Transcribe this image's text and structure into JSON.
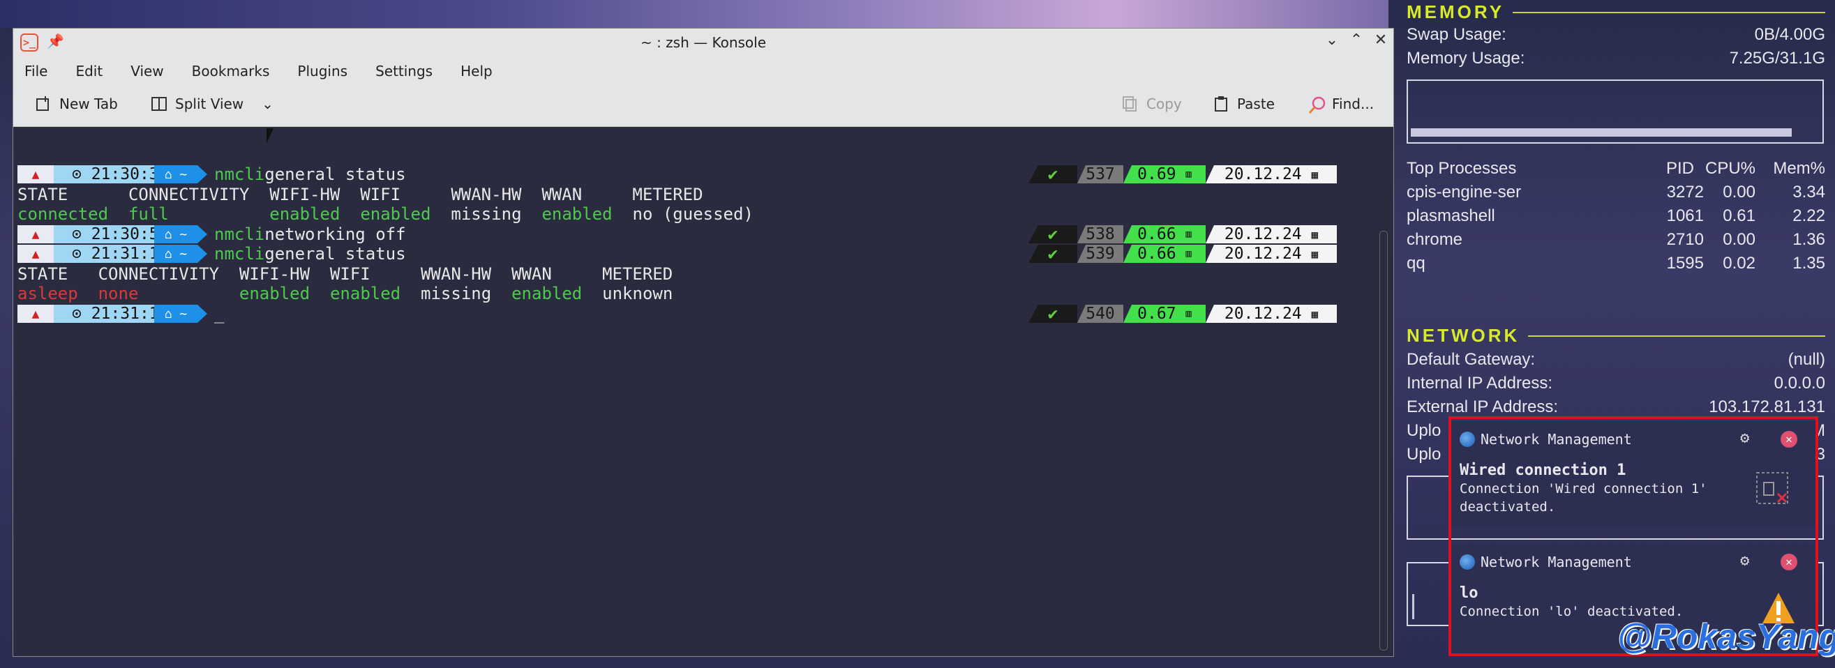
{
  "window": {
    "title": "~ : zsh — Konsole",
    "menu": [
      "File",
      "Edit",
      "View",
      "Bookmarks",
      "Plugins",
      "Settings",
      "Help"
    ],
    "toolbar": {
      "new_tab": "New Tab",
      "split_view": "Split View",
      "copy": "Copy",
      "paste": "Paste",
      "find": "Find..."
    }
  },
  "terminal": {
    "prompts": [
      {
        "time": "21:30:35",
        "home": "~",
        "cmd": "nmcli",
        "args": " general status",
        "status": "✔",
        "num": "537",
        "load": "0.69",
        "date": "20.12.24"
      },
      {
        "time": "21:30:59",
        "home": "~",
        "cmd": "nmcli",
        "args": " networking off",
        "status": "✔",
        "num": "538",
        "load": "0.66",
        "date": "20.12.24"
      },
      {
        "time": "21:31:11",
        "home": "~",
        "cmd": "nmcli",
        "args": " general status",
        "status": "✔",
        "num": "539",
        "load": "0.66",
        "date": "20.12.24"
      },
      {
        "time": "21:31:14",
        "home": "~",
        "cmd": "",
        "args": "_",
        "status": "✔",
        "num": "540",
        "load": "0.67",
        "date": "20.12.24"
      }
    ],
    "out1_header": "STATE      CONNECTIVITY  WIFI-HW  WIFI     WWAN-HW  WWAN     METERED",
    "out1_state": "connected",
    "out1_conn": "full",
    "out1_wifihw": "enabled",
    "out1_wifi": "enabled",
    "out1_wwanhw": "missing",
    "out1_wwan": "enabled",
    "out1_metered": "no (guessed)",
    "out2_header": "STATE   CONNECTIVITY  WIFI-HW  WIFI     WWAN-HW  WWAN     METERED",
    "out2_state": "asleep",
    "out2_conn": "none",
    "out2_wifihw": "enabled",
    "out2_wifi": "enabled",
    "out2_wwanhw": "missing",
    "out2_wwan": "enabled",
    "out2_metered": "unknown"
  },
  "memory": {
    "heading": "MEMORY",
    "swap_label": "Swap Usage:",
    "swap_value": "0B/4.00G",
    "mem_label": "Memory Usage:",
    "mem_value": "7.25G/31.1G"
  },
  "processes": {
    "headers": [
      "Top Processes",
      "PID",
      "CPU%",
      "Mem%"
    ],
    "rows": [
      [
        "cpis-engine-ser",
        "3272",
        "0.00",
        "3.34"
      ],
      [
        "plasmashell",
        "1061",
        "0.61",
        "2.22"
      ],
      [
        "chrome",
        "2710",
        "0.00",
        "1.36"
      ],
      [
        "qq",
        "1595",
        "0.02",
        "1.35"
      ]
    ]
  },
  "network": {
    "heading": "NETWORK",
    "gateway_label": "Default Gateway:",
    "gateway_value": "(null)",
    "internal_label": "Internal IP Address:",
    "internal_value": "0.0.0.0",
    "external_label": "External IP Address:",
    "external_value": "103.172.81.131",
    "upload_label_1": "Uplo",
    "upload_value_1": "M",
    "upload_label_2": "Uplo",
    "upload_value_2": "33"
  },
  "notifications": [
    {
      "app": "Network Management",
      "title": "Wired connection 1",
      "body1": "Connection 'Wired connection 1'",
      "body2": "deactivated."
    },
    {
      "app": "Network Management",
      "title": "lo",
      "body1": "Connection 'lo' deactivated.",
      "body2": ""
    }
  ],
  "watermark": "@RokasYang"
}
